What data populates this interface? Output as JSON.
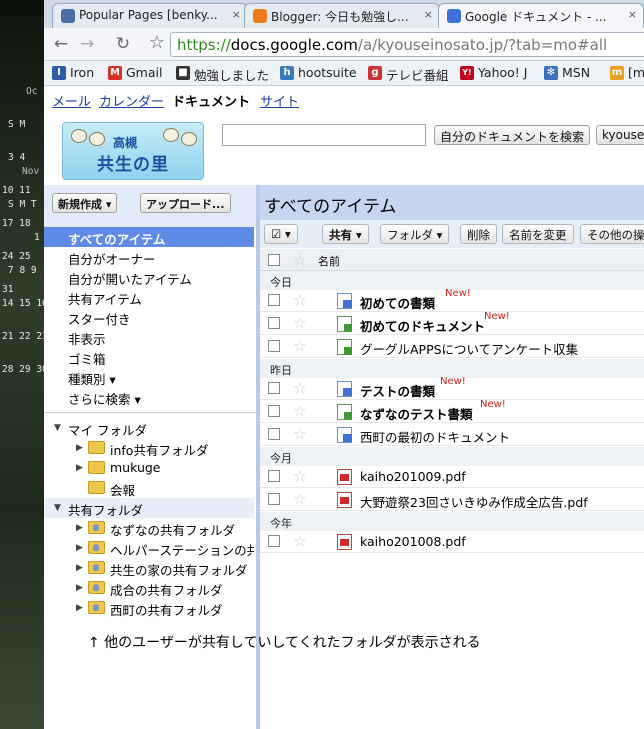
{
  "desktop": {
    "calendar1": {
      "month": "Oc",
      "header": "S M",
      "rows": [
        "3 4",
        "10 11",
        "17 18",
        "24 25",
        "31"
      ]
    },
    "calendar2": {
      "month": "Nov",
      "header": "S M T",
      "rows": [
        "1",
        "7 8 9",
        "14 15 16",
        "21 22 23",
        "28 29 30"
      ]
    }
  },
  "browser": {
    "tabs": [
      {
        "title": "Popular Pages [benky...",
        "close": "×",
        "color": "#4a6fa8"
      },
      {
        "title": "Blogger: 今日も勉強し...",
        "close": "×",
        "color": "#f07b20"
      },
      {
        "title": "Google ドキュメント - ...",
        "close": "×",
        "color": "#3a74d8"
      }
    ],
    "nav": {
      "back": "←",
      "forward": "→",
      "reload": "↻",
      "bookmark_star": "☆"
    },
    "url": {
      "scheme": "https://",
      "domain": "docs.google.com",
      "path": "/a/kyouseinosato.jp/?tab=mo#all"
    },
    "bookmarks": [
      {
        "label": "Iron",
        "icon": "I",
        "color": "#2f5ca8"
      },
      {
        "label": "Gmail",
        "icon": "M",
        "color": "#d93025"
      },
      {
        "label": "勉強しました",
        "icon": "■",
        "color": "#333333"
      },
      {
        "label": "hootsuite",
        "icon": "h",
        "color": "#3a7ab8"
      },
      {
        "label": "テレビ番組",
        "icon": "g",
        "color": "#cc3333"
      },
      {
        "label": "Yahoo! J",
        "icon": "Y!",
        "color": "#c0001e"
      },
      {
        "label": "MSN",
        "icon": "✻",
        "color": "#3a6fc4"
      },
      {
        "label": "[m",
        "icon": "m",
        "color": "#e8a020"
      }
    ]
  },
  "gbar": {
    "links": [
      "メール",
      "カレンダー"
    ],
    "current": "ドキュメント",
    "last": "サイト"
  },
  "logo": {
    "small": "高槻",
    "big": "共生の里"
  },
  "search": {
    "value": "",
    "button": "自分のドキュメントを検索",
    "user_button": "kyousei"
  },
  "left_nav": {
    "create_button": "新規作成 ▾",
    "upload_button": "アップロード...",
    "items": [
      "すべてのアイテム",
      "自分がオーナー",
      "自分が開いたアイテム",
      "共有アイテム",
      "スター付き",
      "非表示",
      "ゴミ箱",
      "種類別 ▾",
      "さらに検索 ▾"
    ],
    "my_folders_label": "マイ フォルダ",
    "my_folders": [
      "info共有フォルダ",
      "mukuge",
      "会報"
    ],
    "shared_folders_label": "共有フォルダ",
    "shared_folders": [
      "なずなの共有フォルダ",
      "ヘルパーステーションの共有",
      "共生の家の共有フォルダ",
      "成合の共有フォルダ",
      "西町の共有フォルダ"
    ]
  },
  "main": {
    "title": "すべてのアイテム",
    "actions": {
      "check": "☑ ▾",
      "share": "共有 ▾",
      "folder": "フォルダ ▾",
      "delete": "削除",
      "rename": "名前を変更",
      "more": "その他の操作"
    },
    "column_name": "名前",
    "groups": [
      {
        "label": "今日",
        "items": [
          {
            "name": "初めての書類",
            "type": "doc",
            "new": "New!",
            "bold": true
          },
          {
            "name": "初めてのドキュメント",
            "type": "sheet",
            "new": "New!",
            "bold": true
          },
          {
            "name": "グーグルAPPSについてアンケート収集",
            "type": "sheet",
            "new": "",
            "bold": false
          }
        ]
      },
      {
        "label": "昨日",
        "items": [
          {
            "name": "テストの書類",
            "type": "doc",
            "new": "New!",
            "bold": true
          },
          {
            "name": "なずなのテスト書類",
            "type": "sheet",
            "new": "New!",
            "bold": true
          },
          {
            "name": "西町の最初のドキュメント",
            "type": "doc",
            "new": "",
            "bold": false
          }
        ]
      },
      {
        "label": "今月",
        "items": [
          {
            "name": "kaiho201009.pdf",
            "type": "pdf",
            "new": "",
            "bold": false
          },
          {
            "name": "大野遊祭23回さいきゆみ作成全広告.pdf",
            "type": "pdf",
            "new": "",
            "bold": false
          }
        ]
      },
      {
        "label": "今年",
        "items": [
          {
            "name": "kaiho201008.pdf",
            "type": "pdf",
            "new": "",
            "bold": false
          }
        ]
      }
    ]
  },
  "annotation": "↑ 他のユーザーが共有していしてくれたフォルダが表示される"
}
